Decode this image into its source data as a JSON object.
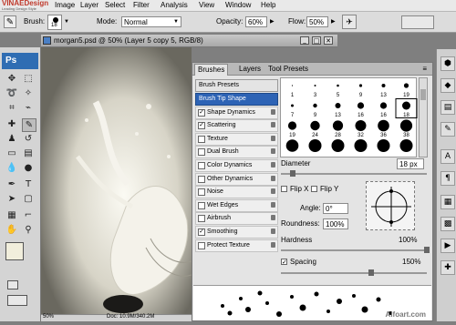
{
  "logo": {
    "brand": "VINAEDesign",
    "tagline": "Leading Design Style"
  },
  "menu": [
    "Image",
    "Layer",
    "Select",
    "Filter",
    "Analysis",
    "View",
    "Window",
    "Help"
  ],
  "options": {
    "brush_label": "Brush:",
    "brush_size": "18",
    "mode_label": "Mode:",
    "mode_value": "Normal",
    "opacity_label": "Opacity:",
    "opacity_value": "60%",
    "flow_label": "Flow:",
    "flow_value": "50%"
  },
  "toolbox": {
    "ps_label": "Ps"
  },
  "document": {
    "title": "morgan5.psd @ 50% (Layer 5 copy 5, RGB/8)",
    "zoom": "50%",
    "doc_info": "Doc: 10.9M/340.2M"
  },
  "brushes_panel": {
    "tabs": [
      "Brushes",
      "Layers",
      "Tool Presets"
    ],
    "presets_label": "Brush Presets",
    "items": [
      {
        "label": "Brush Tip Shape",
        "checked": null,
        "selected": true
      },
      {
        "label": "Shape Dynamics",
        "checked": true
      },
      {
        "label": "Scattering",
        "checked": true
      },
      {
        "label": "Texture",
        "checked": false
      },
      {
        "label": "Dual Brush",
        "checked": false
      },
      {
        "label": "Color Dynamics",
        "checked": false
      },
      {
        "label": "Other Dynamics",
        "checked": false
      },
      {
        "label": "Noise",
        "checked": false
      },
      {
        "label": "Wet Edges",
        "checked": false
      },
      {
        "label": "Airbrush",
        "checked": false
      },
      {
        "label": "Smoothing",
        "checked": true
      },
      {
        "label": "Protect Texture",
        "checked": false
      }
    ],
    "grid_row1": [
      "1",
      "3",
      "5",
      "9",
      "13",
      "19"
    ],
    "grid_row2": [
      "5",
      "9",
      "13",
      "17",
      "21",
      "27"
    ],
    "grid_row3": [
      "35",
      "45",
      "65",
      "100",
      "200",
      "300"
    ],
    "tip_labels_r2": [
      "7",
      "9",
      "13",
      "16",
      "16",
      "18"
    ],
    "tip_labels_r3": [
      "19",
      "24",
      "28",
      "32",
      "36",
      "38"
    ],
    "diameter_label": "Diameter",
    "diameter_value": "18 px",
    "flip_x": "Flip X",
    "flip_y": "Flip Y",
    "angle_label": "Angle:",
    "angle_value": "0°",
    "roundness_label": "Roundness:",
    "roundness_value": "100%",
    "hardness_label": "Hardness",
    "hardness_value": "100%",
    "spacing_label": "Spacing",
    "spacing_value": "150%",
    "spacing_checked": true
  },
  "watermark": "Alfoart.com"
}
